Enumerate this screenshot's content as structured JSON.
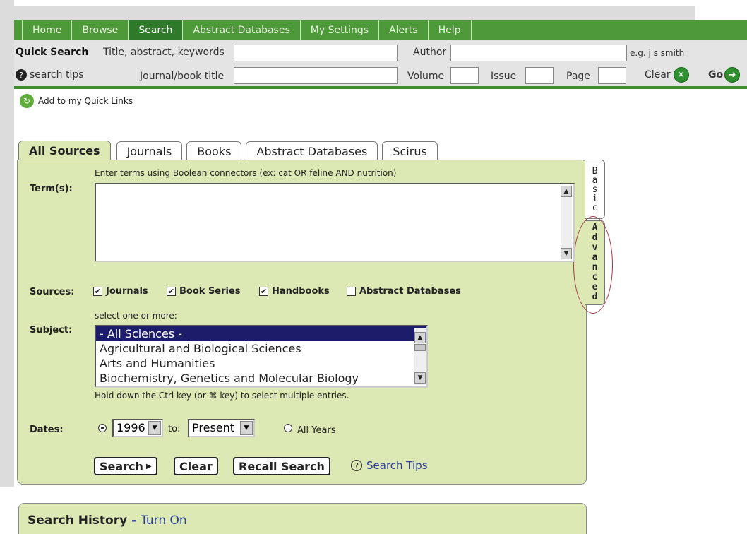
{
  "nav": {
    "items": [
      {
        "label": "Home"
      },
      {
        "label": "Browse"
      },
      {
        "label": "Search"
      },
      {
        "label": "Abstract Databases"
      },
      {
        "label": "My Settings"
      },
      {
        "label": "Alerts"
      },
      {
        "label": "Help"
      }
    ],
    "active": "Search"
  },
  "quick_search": {
    "title": "Quick Search",
    "title_abstract_label": "Title, abstract, keywords",
    "author_label": "Author",
    "author_example": "e.g. j s smith",
    "search_tips": "search tips",
    "journal_label": "Journal/book title",
    "volume_label": "Volume",
    "issue_label": "Issue",
    "page_label": "Page",
    "clear_label": "Clear",
    "go_label": "Go"
  },
  "quick_links": "Add to my Quick Links",
  "tabs": [
    {
      "label": "All Sources"
    },
    {
      "label": "Journals"
    },
    {
      "label": "Books"
    },
    {
      "label": "Abstract Databases"
    },
    {
      "label": "Scirus"
    }
  ],
  "side_tabs": {
    "basic": "Basic",
    "advanced": "Advanced"
  },
  "form": {
    "terms_hint": "Enter terms using Boolean connectors (ex: cat OR feline AND nutrition)",
    "terms_label": "Term(s):",
    "sources_label": "Sources:",
    "sources": [
      {
        "label": "Journals",
        "checked": true
      },
      {
        "label": "Book Series",
        "checked": true
      },
      {
        "label": "Handbooks",
        "checked": true
      },
      {
        "label": "Abstract Databases",
        "checked": false
      }
    ],
    "subject_hint": "select one or more:",
    "subject_label": "Subject:",
    "subjects": [
      "- All Sciences -",
      "Agricultural and Biological Sciences",
      "Arts and Humanities",
      "Biochemistry, Genetics and Molecular Biology"
    ],
    "subject_note": "Hold down the Ctrl key (or ⌘ key) to select multiple entries.",
    "dates_label": "Dates:",
    "date_from": "1996",
    "date_to_label": "to:",
    "date_to": "Present",
    "all_years": "All Years",
    "search_button": "Search",
    "clear_button": "Clear",
    "recall_button": "Recall Search",
    "search_tips": "Search Tips"
  },
  "history": {
    "title": "Search History",
    "sep": "-",
    "link": "Turn On"
  },
  "colors": {
    "nav_green": "#4e9a3a",
    "panel_green": "#dce9b5",
    "link_blue": "#2a3a9a"
  }
}
